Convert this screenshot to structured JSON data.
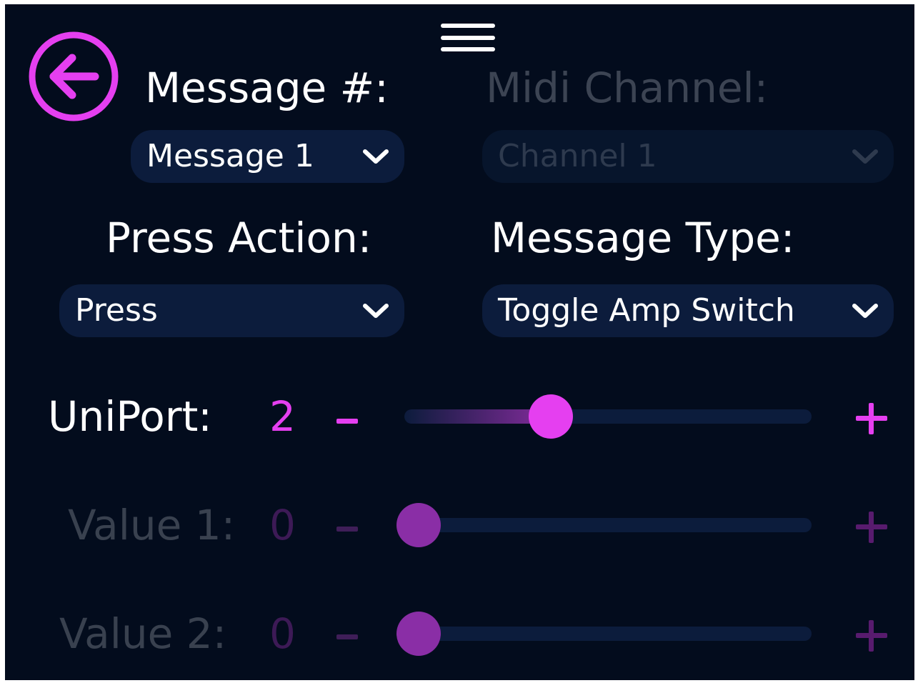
{
  "colors": {
    "background": "#030c1d",
    "accent": "#e53ff0",
    "control_bg": "#0c1c3c",
    "text": "#ffffff",
    "disabled_text": "#3c4453"
  },
  "header": {
    "menu_icon": "hamburger-menu-icon",
    "back_icon": "arrow-left-circle-icon"
  },
  "message_number": {
    "label": "Message #:",
    "selected": "Message 1"
  },
  "midi_channel": {
    "label": "Midi Channel:",
    "selected": "Channel 1",
    "disabled": true
  },
  "press_action": {
    "label": "Press Action:",
    "selected": "Press"
  },
  "message_type": {
    "label": "Message Type:",
    "selected": "Toggle Amp Switch"
  },
  "uniport": {
    "label": "UniPort:",
    "value": "2",
    "minus": "-",
    "plus": "+",
    "slider_fraction": 0.33,
    "disabled": false
  },
  "value1": {
    "label": "Value 1:",
    "value": "0",
    "minus": "-",
    "plus": "+",
    "slider_fraction": 0,
    "disabled": true
  },
  "value2": {
    "label": "Value 2:",
    "value": "0",
    "minus": "-",
    "plus": "+",
    "slider_fraction": 0,
    "disabled": true
  }
}
